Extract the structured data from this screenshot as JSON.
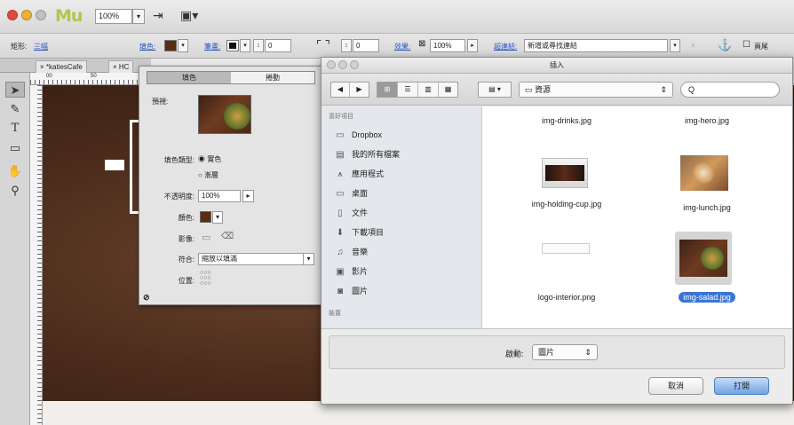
{
  "app": {
    "logo": "Mu",
    "zoom": "100%",
    "icons": [
      "preview-icon",
      "display-options-icon"
    ]
  },
  "controlstrip": {
    "rect_label": "矩形:",
    "rect_value": "三幅",
    "fill_label": "填色:",
    "stroke_label": "筆畫:",
    "stroke_width": "0",
    "position_value": "0",
    "effects_label": "效果:",
    "opacity_value": "100%",
    "hyperlink_label": "超連結:",
    "hyperlink_value": "新增或尋找連結",
    "wrap_label": "頁尾"
  },
  "doc_tabs": [
    {
      "label": "× *katiesCafe"
    },
    {
      "label": "× HC"
    }
  ],
  "ruler": {
    "marks": [
      "00",
      "50"
    ]
  },
  "fill_panel": {
    "tab_fill": "填色",
    "tab_stroke": "捲動",
    "preview_label": "預視:",
    "fill_type_label": "填色類型:",
    "fill_solid": "實色",
    "fill_gradient": "漸層",
    "opacity_label": "不透明度:",
    "opacity_value": "100%",
    "color_label": "顏色:",
    "image_label": "影像:",
    "fit_label": "符合:",
    "fit_value": "縮放以填滿",
    "position_label": "位置:",
    "colors": {
      "fill": "#5a2c15"
    }
  },
  "dialog": {
    "title": "插入",
    "path": "資源",
    "search_placeholder": "Q",
    "sidebar_heading_favorites": "喜好項目",
    "sidebar_heading_shared": "裝置",
    "sidebar": [
      {
        "icon": "folder-icon",
        "label": "Dropbox"
      },
      {
        "icon": "all-files-icon",
        "label": "我的所有檔案"
      },
      {
        "icon": "applications-icon",
        "label": "應用程式"
      },
      {
        "icon": "desktop-icon",
        "label": "桌面"
      },
      {
        "icon": "documents-icon",
        "label": "文件"
      },
      {
        "icon": "downloads-icon",
        "label": "下載項目"
      },
      {
        "icon": "music-icon",
        "label": "音樂"
      },
      {
        "icon": "movies-icon",
        "label": "影片"
      },
      {
        "icon": "pictures-icon",
        "label": "圖片"
      }
    ],
    "files": [
      {
        "name": "img-drinks.jpg"
      },
      {
        "name": "img-hero.jpg"
      },
      {
        "name": "img-holding-cup.jpg"
      },
      {
        "name": "img-lunch.jpg"
      },
      {
        "name": "logo-interior.png"
      },
      {
        "name": "img-salad.jpg"
      }
    ],
    "enable_label": "啟動:",
    "enable_value": "圖片",
    "cancel": "取消",
    "open": "打開"
  }
}
